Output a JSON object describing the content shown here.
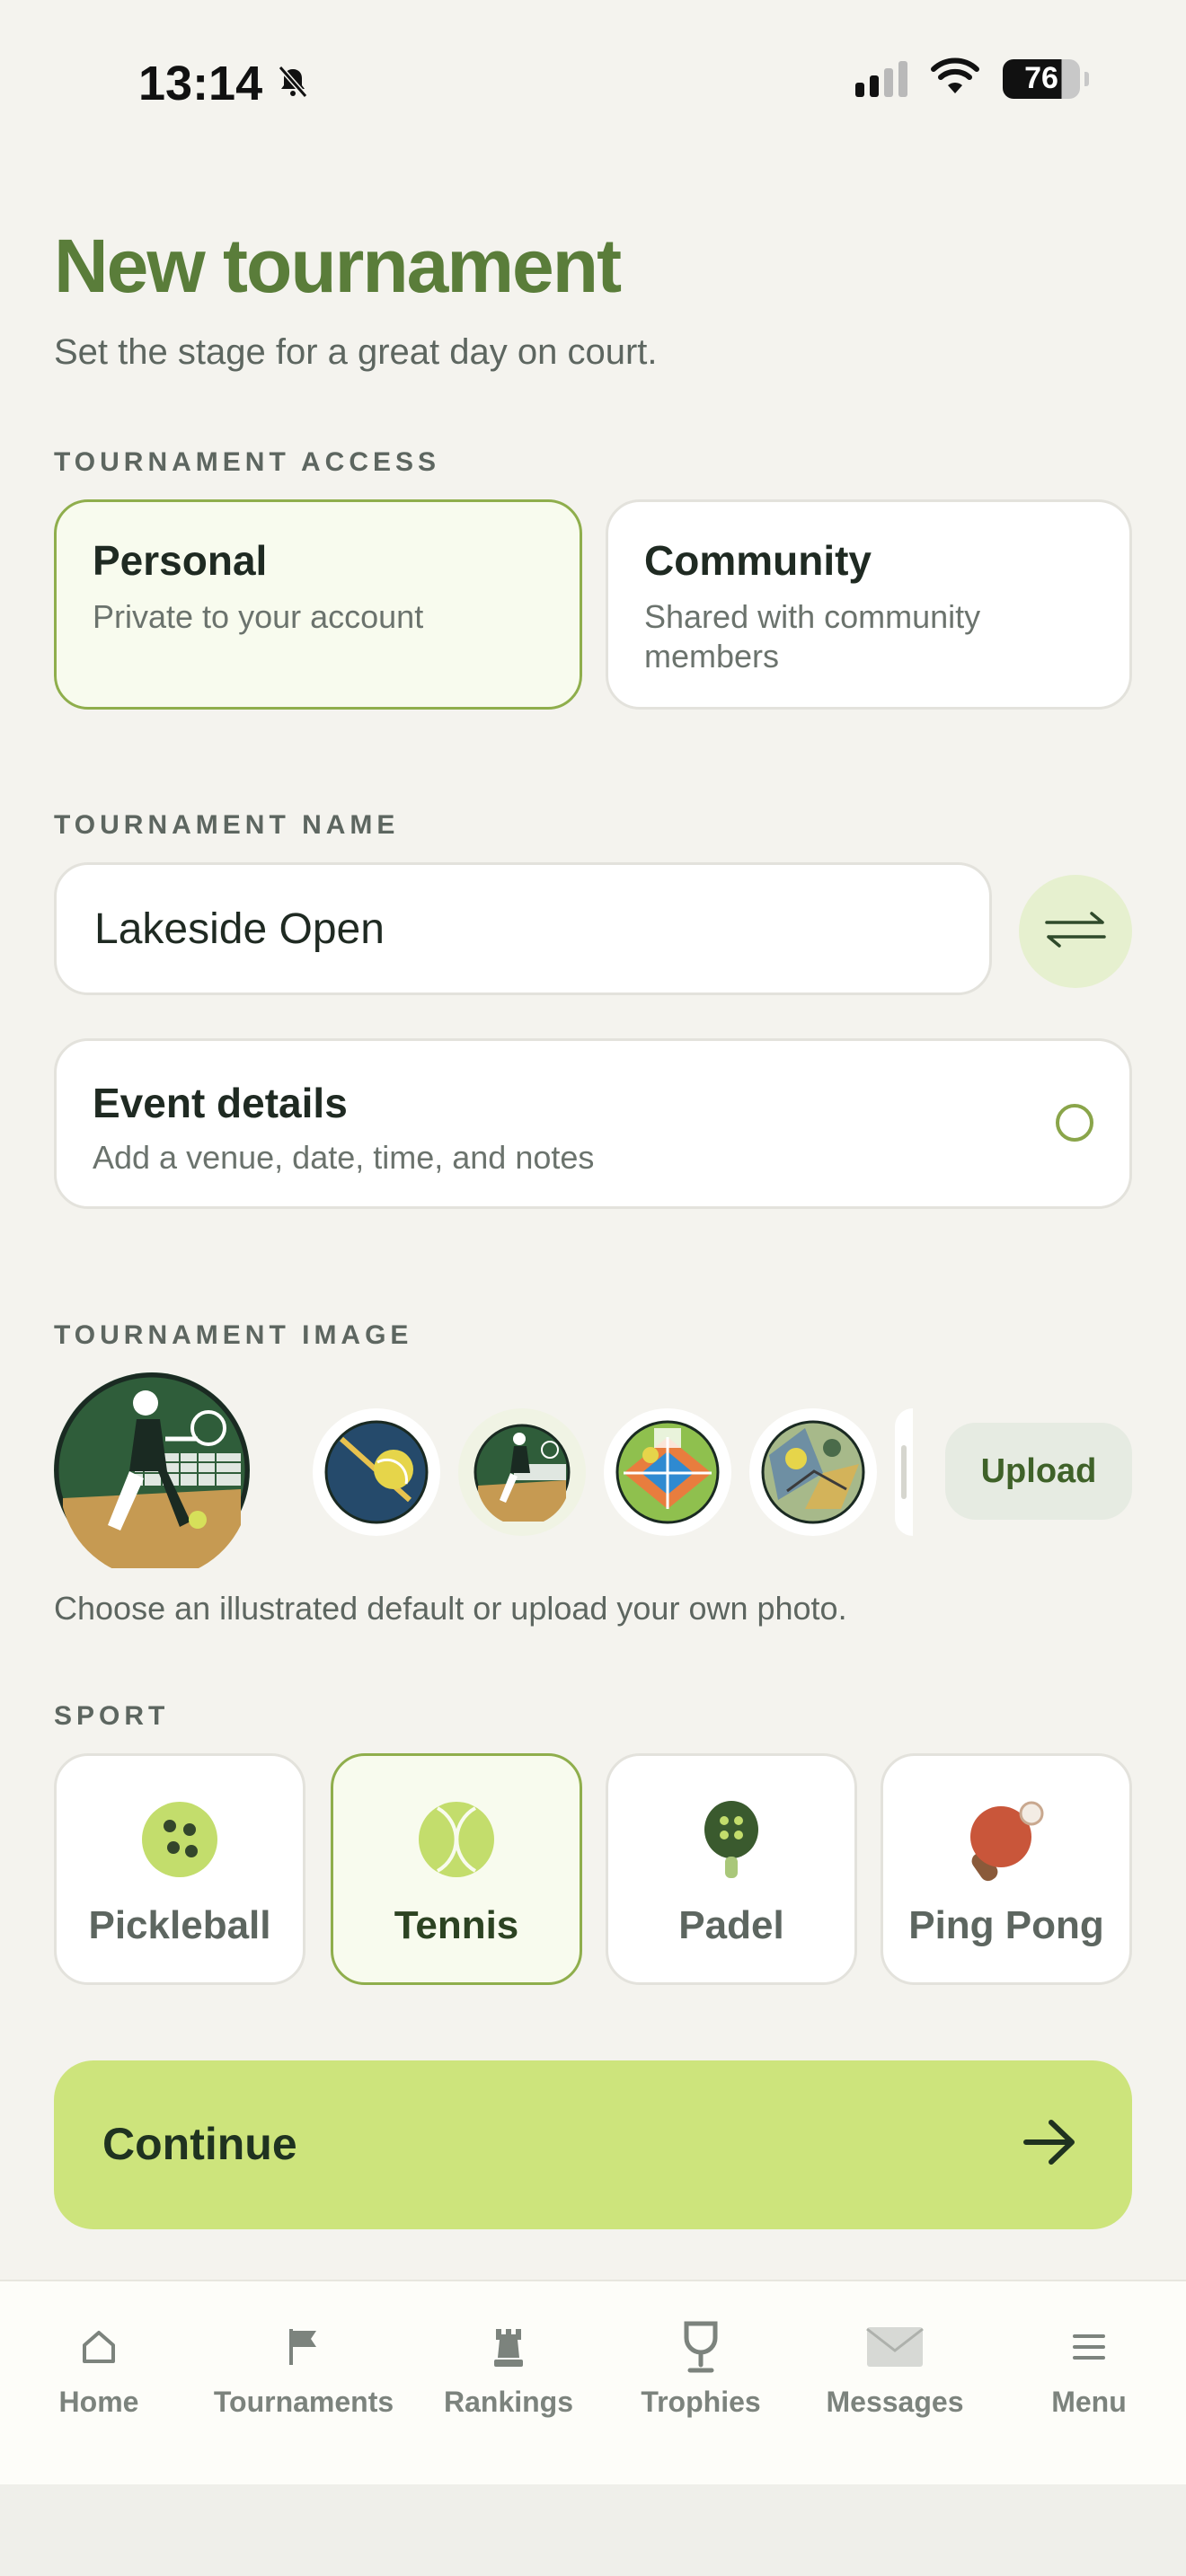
{
  "status_bar": {
    "time": "13:14",
    "battery": "76"
  },
  "header": {
    "title": "New tournament",
    "subtitle": "Set the stage for a great day on court."
  },
  "access": {
    "label": "TOURNAMENT ACCESS",
    "options": [
      {
        "title": "Personal",
        "description": "Private to your account",
        "selected": true
      },
      {
        "title": "Community",
        "description": "Shared with community members",
        "selected": false
      }
    ]
  },
  "name": {
    "label": "TOURNAMENT NAME",
    "value": "Lakeside Open"
  },
  "event_details": {
    "title": "Event details",
    "description": "Add a venue, date, time, and notes"
  },
  "image": {
    "label": "TOURNAMENT IMAGE",
    "upload_label": "Upload",
    "hint": "Choose an illustrated default or upload your own photo."
  },
  "sport": {
    "label": "SPORT",
    "options": [
      {
        "label": "Pickleball",
        "icon": "pickleball-icon",
        "selected": false
      },
      {
        "label": "Tennis",
        "icon": "tennis-ball-icon",
        "selected": true
      },
      {
        "label": "Padel",
        "icon": "padel-racket-icon",
        "selected": false
      },
      {
        "label": "Ping Pong",
        "icon": "ping-pong-paddle-icon",
        "selected": false
      }
    ]
  },
  "continue_label": "Continue",
  "tabbar": {
    "items": [
      {
        "label": "Home",
        "icon": "home-icon"
      },
      {
        "label": "Tournaments",
        "icon": "flag-icon"
      },
      {
        "label": "Rankings",
        "icon": "rook-icon"
      },
      {
        "label": "Trophies",
        "icon": "trophy-icon"
      },
      {
        "label": "Messages",
        "icon": "envelope-icon"
      },
      {
        "label": "Menu",
        "icon": "hamburger-icon"
      }
    ]
  },
  "colors": {
    "accent": "#5a7d3a",
    "button": "#cde47c",
    "selected_border": "#8fae4c",
    "background": "#f4f3ee"
  }
}
